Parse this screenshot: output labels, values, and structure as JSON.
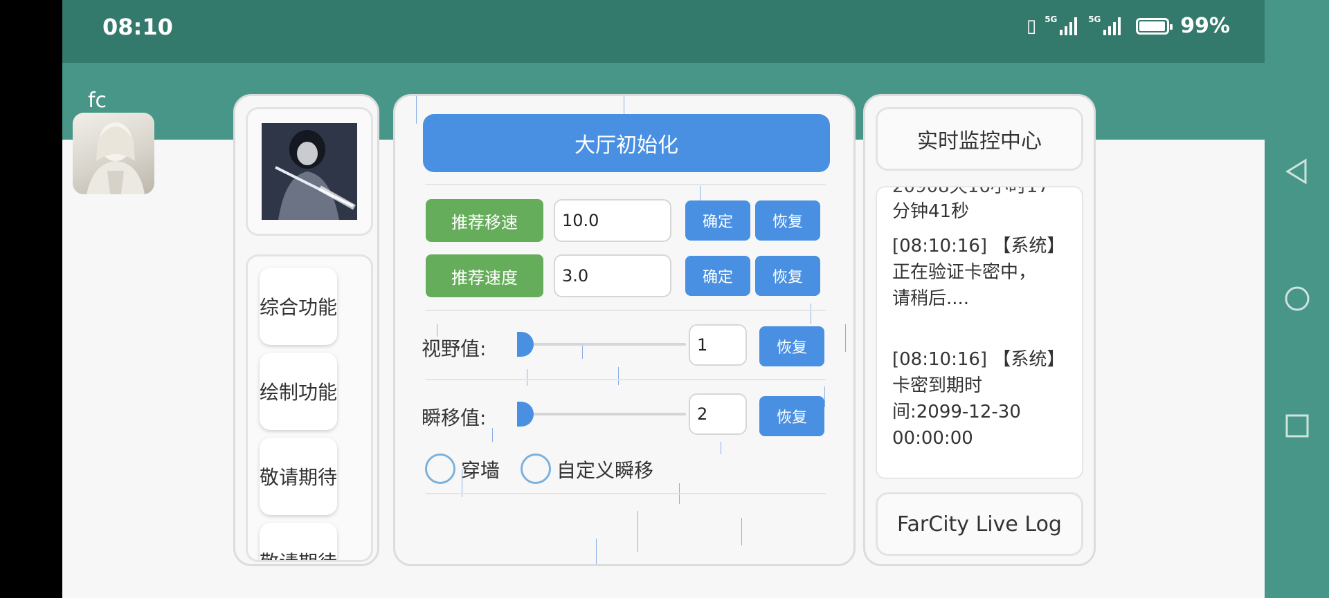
{
  "status": {
    "time": "08:10",
    "net1": "5G",
    "net2": "5G",
    "battery": "99%"
  },
  "floating": {
    "label": "fc"
  },
  "sidebar": {
    "items": [
      "综合功能",
      "绘制功能",
      "敬请期待",
      "敬请期待"
    ]
  },
  "main": {
    "init_button": "大厅初始化",
    "rows": [
      {
        "label": "推荐移速",
        "value": "10.0",
        "confirm": "确定",
        "restore": "恢复"
      },
      {
        "label": "推荐速度",
        "value": "3.0",
        "confirm": "确定",
        "restore": "恢复"
      }
    ],
    "sliders": [
      {
        "label": "视野值:",
        "value": "1",
        "restore": "恢复",
        "level": 0
      },
      {
        "label": "瞬移值:",
        "value": "2",
        "restore": "恢复",
        "level": 0
      }
    ],
    "radios": [
      {
        "label": "穿墙"
      },
      {
        "label": "自定义瞬移"
      }
    ]
  },
  "monitor": {
    "title": "实时监控中心",
    "log_lines": [
      "分钟41秒",
      "[08:10:16] 【系统】",
      "正在验证卡密中，",
      "请稍后....",
      "",
      "[08:10:16] 【系统】",
      "卡密到期时",
      "间:2099-12-30",
      "00:00:00"
    ],
    "footer": "FarCity Live Log"
  },
  "colors": {
    "status_bar": "#347a6c",
    "teal": "#479688",
    "accent_blue": "#4a90e2",
    "accent_green": "#66ad5b"
  }
}
